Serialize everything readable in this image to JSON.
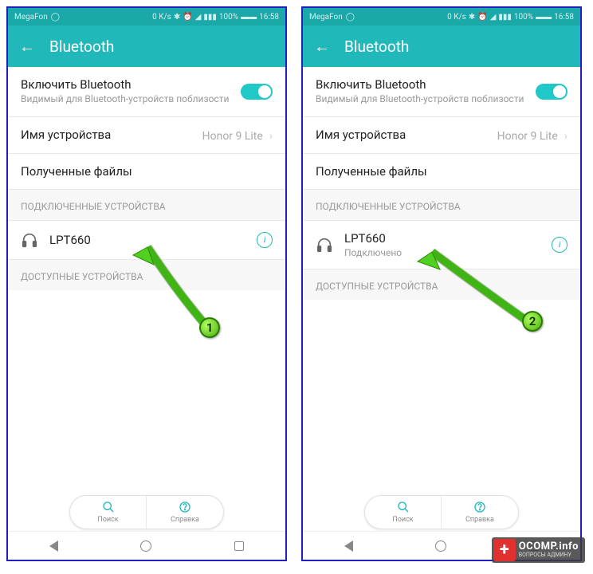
{
  "status": {
    "carrier": "MegaFon",
    "speed": "0 K/s",
    "battery": "100%",
    "time": "16:58"
  },
  "header": {
    "title": "Bluetooth"
  },
  "rows": {
    "enable_title": "Включить Bluetooth",
    "enable_sub": "Видимый для Bluetooth-устройств поблизости",
    "devname_title": "Имя устройства",
    "devname_val": "Honor 9 Lite",
    "files_title": "Полученные файлы"
  },
  "sections": {
    "connected": "ПОДКЛЮЧЕННЫЕ УСТРОЙСТВА",
    "available": "ДОСТУПНЫЕ УСТРОЙСТВА"
  },
  "device": {
    "name": "LPT660",
    "status": "Подключено"
  },
  "bottom": {
    "search": "Поиск",
    "help": "Справка"
  },
  "badges": {
    "one": "1",
    "two": "2"
  },
  "watermark": {
    "main": "OCOMP.info",
    "sub": "ВОПРОСЫ АДМИНУ"
  }
}
